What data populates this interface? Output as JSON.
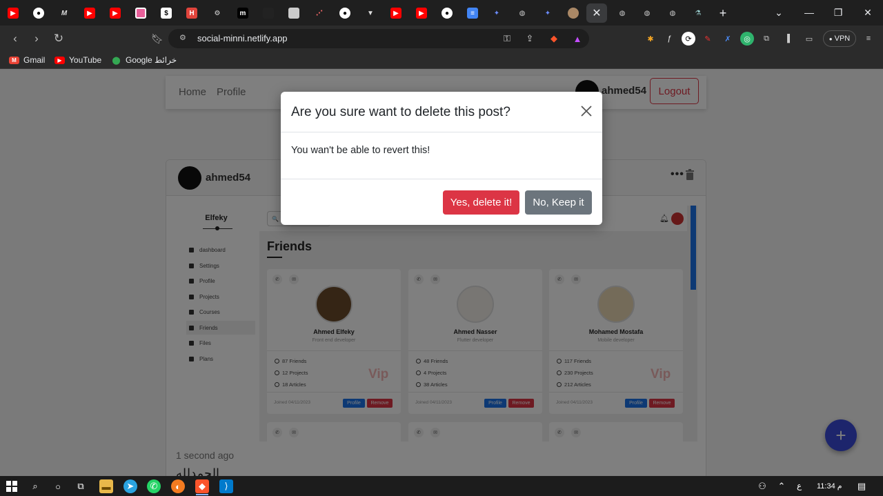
{
  "browser": {
    "url": "social-minni.netlify.app",
    "active_tab_close": "✕",
    "new_tab": "+",
    "vpn_label": "VPN",
    "tab_icons": [
      "youtube-favicon",
      "github-favicon",
      "medium-favicon",
      "youtube-favicon",
      "youtube-favicon",
      "pink-favicon",
      "notion-favicon",
      "h-favicon",
      "chatgpt-favicon",
      "m-favicon",
      "dark-favicon",
      "gray-favicon",
      "dots-favicon",
      "github-favicon",
      "vercel-favicon",
      "youtube-favicon",
      "youtube-favicon",
      "github-favicon",
      "docs-favicon",
      "wand-favicon",
      "globe-favicon",
      "wand-favicon",
      "avatar-favicon",
      "close-icon",
      "globe-favicon",
      "globe-favicon",
      "globe-favicon",
      "flask-favicon"
    ]
  },
  "bookmarks": [
    {
      "label": "Gmail",
      "icon": "gmail-icon",
      "color": "#ea4335"
    },
    {
      "label": "YouTube",
      "icon": "youtube-icon",
      "color": "#ff0000"
    },
    {
      "label": "Google خرائط",
      "icon": "maps-icon",
      "color": "#34a853"
    }
  ],
  "navbar": {
    "home": "Home",
    "profile": "Profile",
    "username": "ahmed54",
    "logout": "Logout"
  },
  "post": {
    "username": "ahmed54",
    "more": "•••",
    "time": "1 second ago",
    "text": "الحمدلله"
  },
  "post_image": {
    "brand": "Elfeky",
    "menu": [
      "dashboard",
      "Settings",
      "Profile",
      "Projects",
      "Courses",
      "Friends",
      "Files",
      "Plans"
    ],
    "search_placeholder": "🔍",
    "page_title": "Friends",
    "cards": [
      {
        "name": "Ahmed Elfeky",
        "role": "Front end developer",
        "friends": "87 Friends",
        "projects": "12 Projects",
        "articles": "18 Articles",
        "vip": "Vip",
        "joined": "Joined 04/11/2023",
        "profile_btn": "Profile",
        "remove_btn": "Remove",
        "photo_color": "#6b4a2a"
      },
      {
        "name": "Ahmed Nasser",
        "role": "Flutter developer",
        "friends": "48 Friends",
        "projects": "4 Projects",
        "articles": "38 Articles",
        "vip": "",
        "joined": "Joined 04/11/2023",
        "profile_btn": "Profile",
        "remove_btn": "Remove",
        "photo_color": "#f1ece6"
      },
      {
        "name": "Mohamed Mostafa",
        "role": "Mobile developer",
        "friends": "117 Friends",
        "projects": "230 Projects",
        "articles": "212 Articles",
        "vip": "Vip",
        "joined": "Joined 04/11/2023",
        "profile_btn": "Profile",
        "remove_btn": "Remove",
        "photo_color": "#e9d7b3"
      }
    ]
  },
  "modal": {
    "title": "Are you sure want to delete this post?",
    "body": "You wan't be able to revert this!",
    "confirm": "Yes, delete it!",
    "cancel": "No, Keep it"
  },
  "fab_label": "+",
  "taskbar": {
    "time": "11:34 م",
    "lang": "ع"
  },
  "colors": {
    "danger": "#dc3545",
    "secondary": "#6c757d",
    "primary": "#1a73e8",
    "fab": "#3a4bd8"
  }
}
